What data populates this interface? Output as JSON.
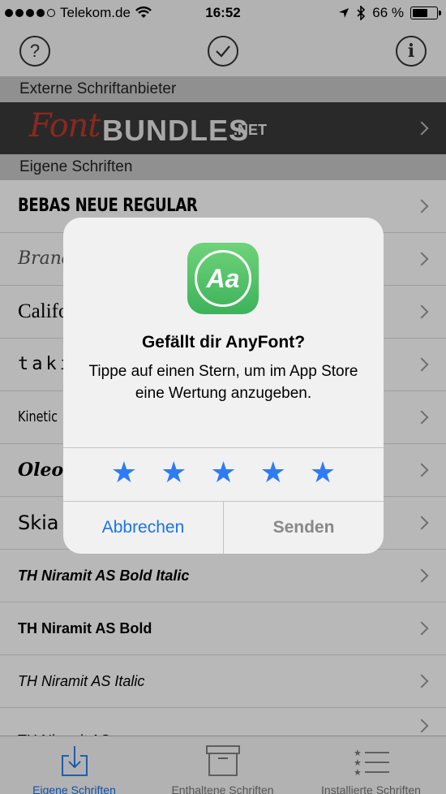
{
  "status_bar": {
    "carrier": "Telekom.de",
    "time": "16:52",
    "battery_percent": "66 %",
    "battery_level": 0.66
  },
  "toolbar": {
    "help_label": "?",
    "info_label": "i"
  },
  "sections": {
    "external": "Externe Schriftanbieter",
    "own": "Eigene Schriften"
  },
  "banner": {
    "part1": "Font",
    "part2": "BUNDLES",
    "part3": ".NET"
  },
  "fonts": [
    {
      "name": "BEBAS NEUE REGULAR"
    },
    {
      "name": "Brand"
    },
    {
      "name": "Califo"
    },
    {
      "name": "taki"
    },
    {
      "name": "Kinetic"
    },
    {
      "name": "Oleo S"
    },
    {
      "name": "Skia"
    },
    {
      "name": "TH Niramit AS Bold Italic"
    },
    {
      "name": "TH Niramit AS Bold"
    },
    {
      "name": "TH Niramit AS Italic"
    },
    {
      "name": "TH Niramit AS"
    }
  ],
  "dialog": {
    "app_icon_text": "Aa",
    "title": "Gefällt dir AnyFont?",
    "message": "Tippe auf einen Stern, um im App Store eine Wertung anzugeben.",
    "star_glyph": "★",
    "cancel": "Abbrechen",
    "send": "Senden"
  },
  "tabs": [
    {
      "label": "Eigene Schriften",
      "icon": "download-tray-icon",
      "active": true
    },
    {
      "label": "Enthaltene Schriften",
      "icon": "archive-box-icon",
      "active": false
    },
    {
      "label": "Installierte Schriften",
      "icon": "star-list-icon",
      "active": false
    }
  ],
  "colors": {
    "accent": "#1a73e8",
    "star": "#2f7bf5",
    "app_icon": "#4cc266"
  }
}
